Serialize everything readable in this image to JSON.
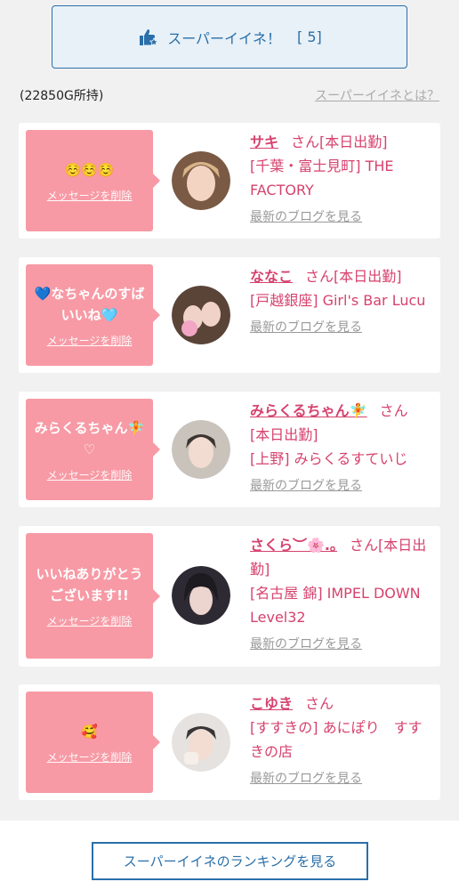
{
  "header": {
    "super_iine_label": "スーパーイイネ！",
    "super_iine_count": "[ 5]",
    "balance": "(22850G所持)",
    "about_link": "スーパーイイネとは？"
  },
  "cards": [
    {
      "message": "☺️☺️☺️",
      "delete_label": "メッセージを削除",
      "name": "サキ",
      "san": "さん[本日出勤]",
      "shop": "[千葉・富士見町] THE FACTORY",
      "blog": "最新のブログを見る"
    },
    {
      "message": "💙なちゃんのすばいいね🩵",
      "delete_label": "メッセージを削除",
      "name": "ななこ",
      "san": "さん[本日出勤]",
      "shop": "[戸越銀座] Girl's Bar Lucu",
      "blog": "最新のブログを見る"
    },
    {
      "message": "みらくるちゃん🧚♡",
      "delete_label": "メッセージを削除",
      "name": "みらくるちゃん🧚",
      "san": "さん",
      "status": "[本日出勤]",
      "shop": "[上野] みらくるすていじ",
      "blog": "最新のブログを見る"
    },
    {
      "message": "いいねありがとうございます!!",
      "delete_label": "メッセージを削除",
      "name": "さくら︶🌸.｡",
      "san": "さん[本日出勤]",
      "shop": "[名古屋 錦] IMPEL DOWN Level32",
      "blog": "最新のブログを見る"
    },
    {
      "message": "🥰",
      "delete_label": "メッセージを削除",
      "name": "こゆき",
      "san": "さん",
      "shop": "[すすきの] あにぽり　すすきの店",
      "blog": "最新のブログを見る"
    }
  ],
  "footer": {
    "ranking_button": "スーパーイイネのランキングを見る"
  },
  "colors": {
    "accent_blue": "#2a6fa9",
    "bubble_pink": "#f79aa5",
    "name_pink": "#d6426e"
  }
}
